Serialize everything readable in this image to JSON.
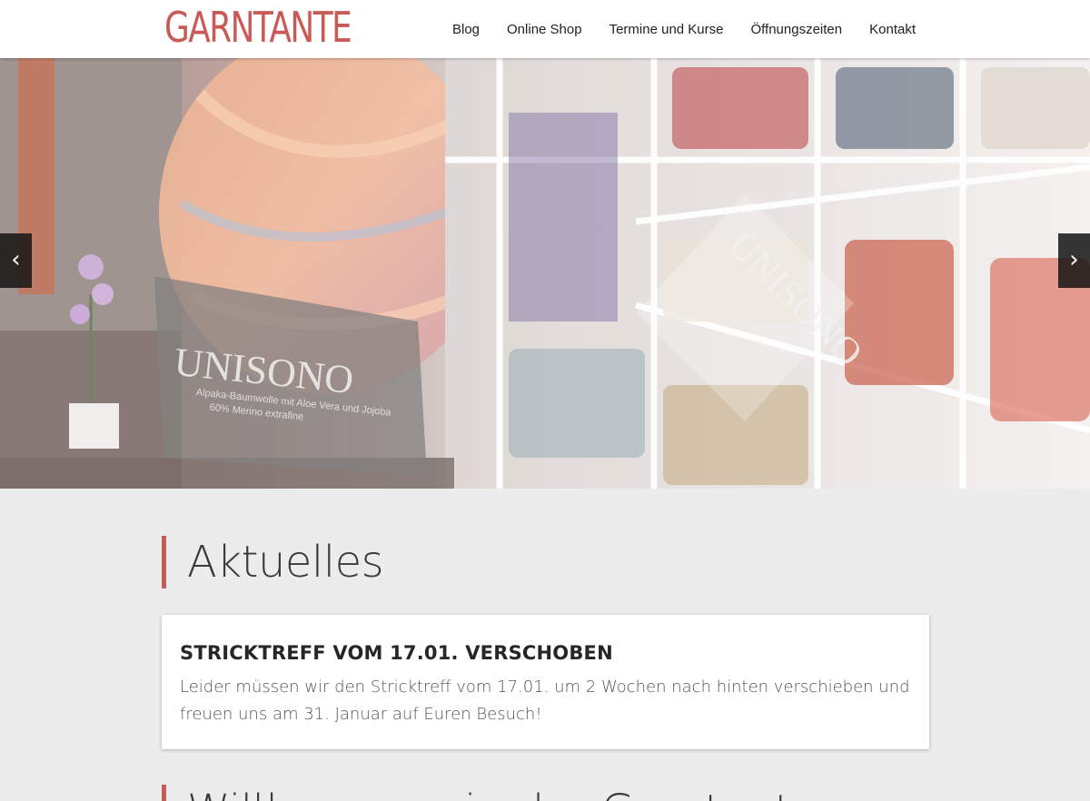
{
  "header": {
    "logo": "GARNTANTE",
    "nav": [
      "Blog",
      "Online Shop",
      "Termine und Kurse",
      "Öffnungszeiten",
      "Kontakt"
    ]
  },
  "hero": {
    "prev_icon": "chevron-left-icon",
    "next_icon": "chevron-right-icon",
    "prev_glyph": "‹",
    "next_glyph": "›",
    "banner_text": "UNISONO",
    "banner_subtext_1": "Alpaka-Baumwolle mit Aloe Vera und Jojoba",
    "banner_subtext_2": "60% Merino extrafine"
  },
  "news": {
    "section_title": "Aktuelles",
    "card_title": "STRICKTREFF VOM 17.01. VERSCHOBEN",
    "card_text": "Leider müssen wir den Stricktreff vom 17.01. um 2 Wochen nach hinten verschieben und freuen uns am 31. Januar auf Euren Besuch!"
  },
  "welcome": {
    "section_title": "Willkommen in der Garntante"
  },
  "colors": {
    "accent": "#c85a57",
    "page_bg": "#ececec",
    "card_bg": "#ffffff",
    "text_dark": "#262626"
  }
}
